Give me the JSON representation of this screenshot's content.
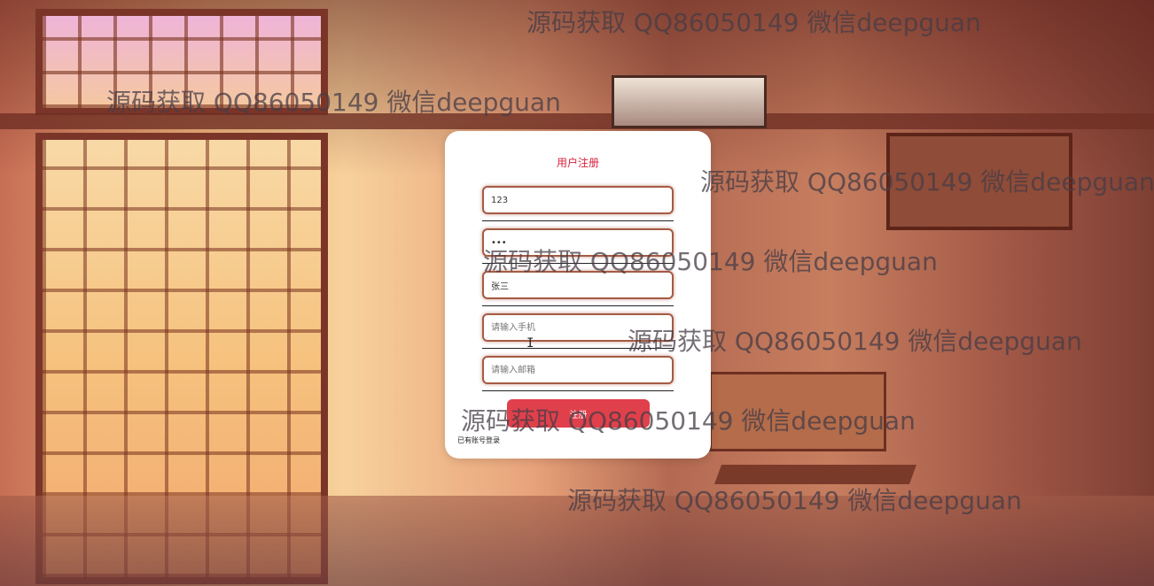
{
  "form": {
    "title": "用户注册",
    "username_value": "123",
    "password_value": "•••",
    "realname_value": "张三",
    "phone_placeholder": "请输入手机",
    "email_placeholder": "请输入邮箱",
    "submit_label": "注册",
    "login_link": "已有账号登录"
  },
  "watermarks": [
    "源码获取 QQ86050149 微信deepguan",
    "源码获取 QQ86050149 微信deepguan",
    "源码获取 QQ86050149 微信deepguan",
    "源码获取 QQ86050149 微信deepguan",
    "源码获取 QQ86050149 微信deepguan",
    "源码获取 QQ86050149 微信deepguan",
    "源码获取 QQ86050149 微信deepguan"
  ],
  "colors": {
    "title": "#d6203a",
    "button": "#e0404b",
    "input_border": "#a65b44"
  }
}
